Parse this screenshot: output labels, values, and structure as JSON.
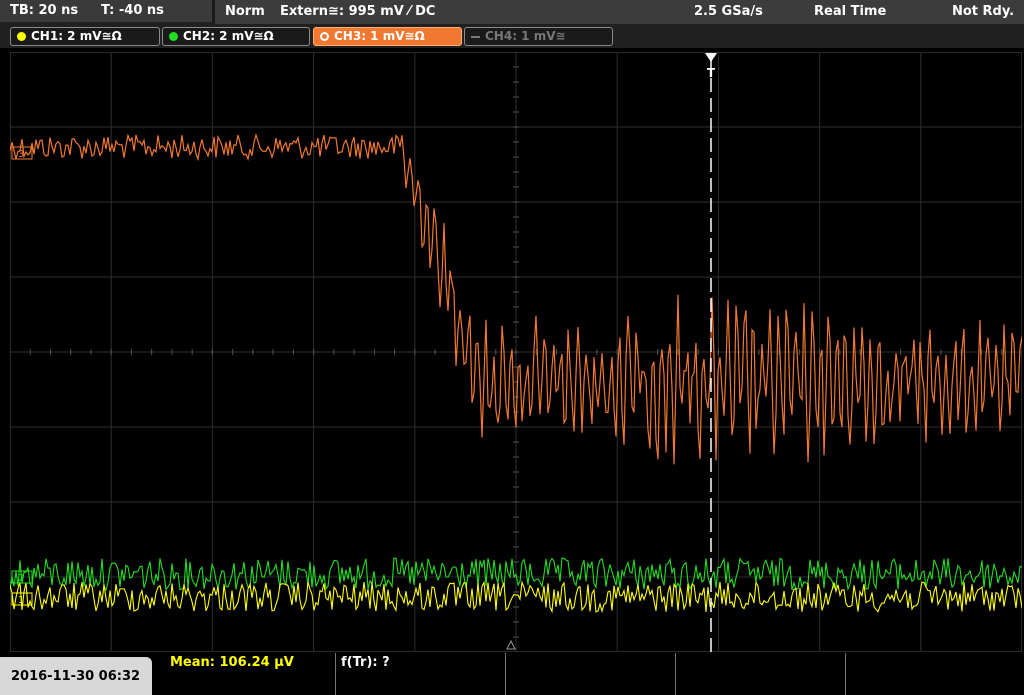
{
  "header": {
    "timebase": "TB: 20 ns",
    "trigger_time": "T: -40 ns",
    "trigger_mode": "Norm",
    "trigger_source": "Extern≅: 995 mV ⁄ DC",
    "sample_rate": "2.5 GSa/s",
    "acq_mode": "Real Time",
    "status": "Not Rdy."
  },
  "channels": [
    {
      "label": "CH1: 2 mV≅Ω",
      "color": "#ffff00",
      "state": "on"
    },
    {
      "label": "CH2: 2 mV≅Ω",
      "color": "#22dd22",
      "state": "on"
    },
    {
      "label": "CH3: 1 mV≅Ω",
      "color": "#f07830",
      "state": "active"
    },
    {
      "label": "CH4: 1 mV≅",
      "color": "#777777",
      "state": "off"
    }
  ],
  "markers": {
    "trigger": "T",
    "ch3": "3",
    "ch2": "2",
    "ch1": "1"
  },
  "footer": {
    "datetime": "2016-11-30 06:32",
    "measurement_1": "Mean: 106.24 μV",
    "measurement_2": "f(Tr): ?"
  },
  "colors": {
    "ch1": "#ffff00",
    "ch2": "#22dd22",
    "ch3": "#f07830",
    "grid": "#3a3a3a"
  }
}
